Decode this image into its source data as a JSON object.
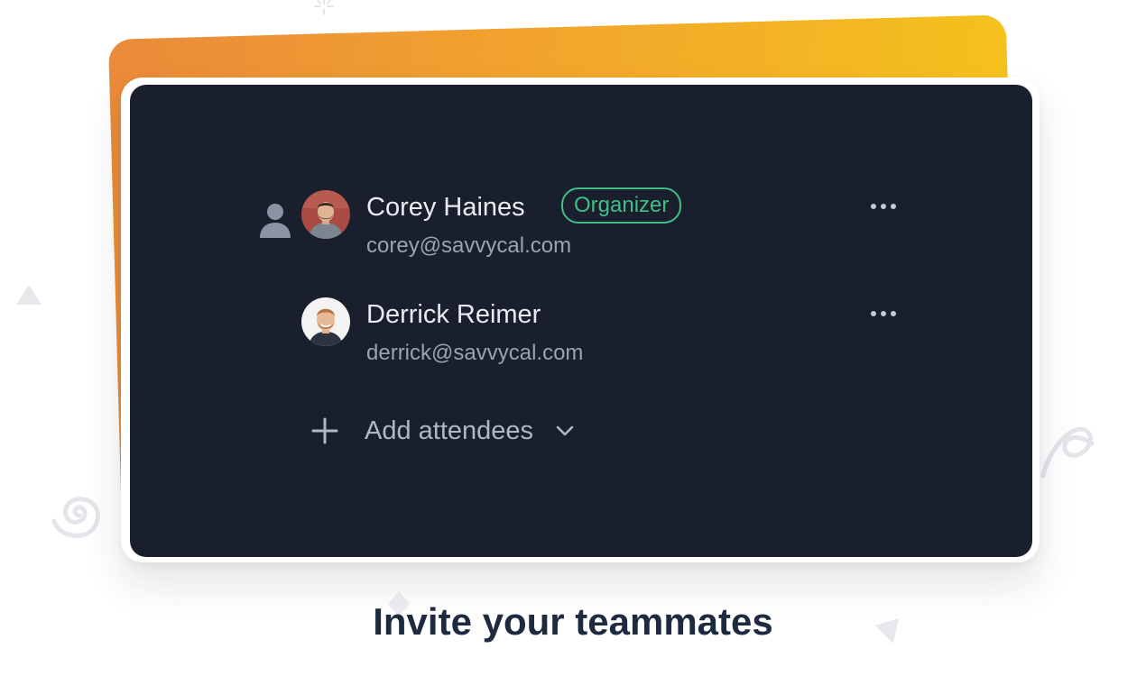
{
  "attendees": [
    {
      "name": "Corey Haines",
      "email": "corey@savvycal.com",
      "role_badge": "Organizer",
      "avatar": "avatar-corey-photo",
      "menu_icon": "more-horizontal-icon"
    },
    {
      "name": "Derrick Reimer",
      "email": "derrick@savvycal.com",
      "avatar": "avatar-derrick-photo",
      "menu_icon": "more-horizontal-icon"
    }
  ],
  "organizer_icon": "person-icon",
  "add_attendees": {
    "label": "Add attendees",
    "icon": "plus-icon",
    "caret": "chevron-down-icon"
  },
  "caption": "Invite your teammates",
  "colors": {
    "panel_background": "#1a1f2e",
    "badge_green": "#3fbf86",
    "gradient_start": "#ea8a3a",
    "gradient_end": "#f5c71a",
    "caption_text": "#1e2a40"
  }
}
